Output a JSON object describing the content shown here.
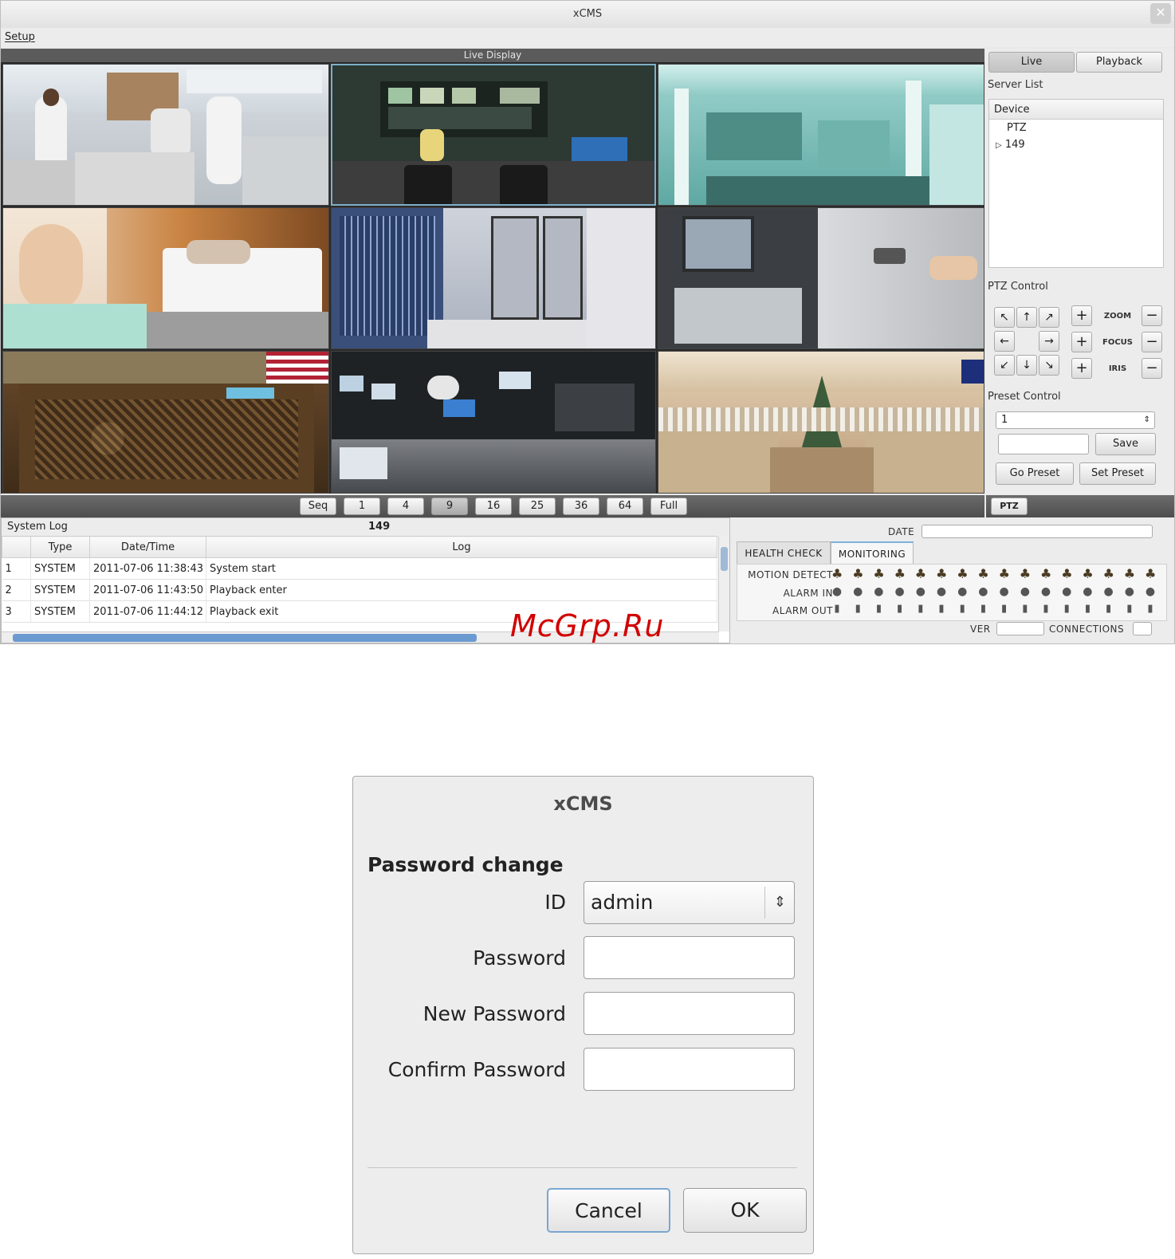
{
  "window": {
    "title": "xCMS",
    "close_glyph": "✕"
  },
  "menu": {
    "setup": "Setup"
  },
  "live": {
    "header": "Live Display"
  },
  "layout_buttons": [
    "Seq",
    "1",
    "4",
    "9",
    "16",
    "25",
    "36",
    "64",
    "Full"
  ],
  "layout_active": "9",
  "side": {
    "live_tab": "Live",
    "playback_tab": "Playback",
    "server_list": "Server List",
    "device_header": "Device",
    "tree": [
      "PTZ",
      "149"
    ],
    "ptz_control": "PTZ Control",
    "zoom": "ZOOM",
    "focus": "FOCUS",
    "iris": "IRIS",
    "preset_control": "Preset Control",
    "preset_value": "1",
    "save": "Save",
    "go_preset": "Go Preset",
    "set_preset": "Set Preset",
    "ptz_tab": "PTZ"
  },
  "log": {
    "title": "System Log",
    "count": "149",
    "columns": [
      "",
      "Type",
      "Date/Time",
      "Log"
    ],
    "rows": [
      [
        "1",
        "SYSTEM",
        "2011-07-06 11:38:43",
        "System start"
      ],
      [
        "2",
        "SYSTEM",
        "2011-07-06 11:43:50",
        "Playback enter"
      ],
      [
        "3",
        "SYSTEM",
        "2011-07-06 11:44:12",
        "Playback exit"
      ]
    ]
  },
  "status": {
    "date_label": "DATE",
    "tab_health": "HEALTH CHECK",
    "tab_monitoring": "MONITORING",
    "motion_detect": "MOTION DETECT",
    "alarm_in": "ALARM IN",
    "alarm_out": "ALARM OUT",
    "ver_label": "VER",
    "connections_label": "CONNECTIONS",
    "channel_count": 16
  },
  "dialog": {
    "title": "xCMS",
    "heading": "Password change",
    "id_label": "ID",
    "id_value": "admin",
    "password_label": "Password",
    "new_password_label": "New Password",
    "confirm_password_label": "Confirm Password",
    "cancel": "Cancel",
    "ok": "OK"
  },
  "watermark": "McGrp.Ru"
}
